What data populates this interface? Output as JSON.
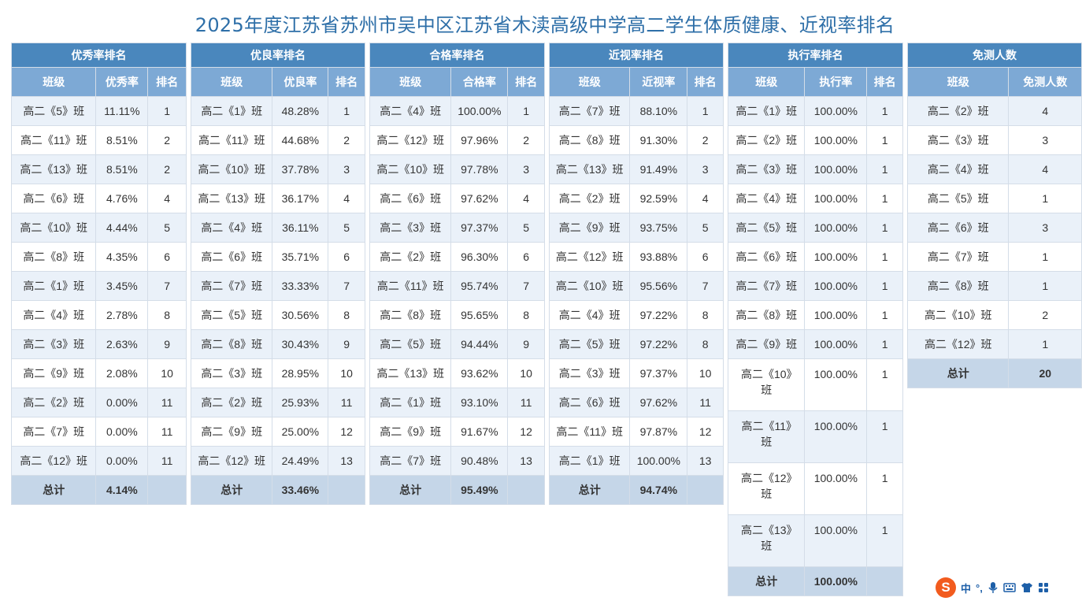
{
  "page": {
    "title": "2025年度江苏省苏州市吴中区江苏省木渎高级中学高二学生体质健康、近视率排名"
  },
  "tables": [
    {
      "id": "excellent",
      "group_label": "优秀率排名",
      "col_class": "班级",
      "col_value": "优秀率",
      "col_rank": "排名",
      "rows": [
        {
          "class": "高二《5》班",
          "value": "11.11%",
          "rank": "1"
        },
        {
          "class": "高二《11》班",
          "value": "8.51%",
          "rank": "2"
        },
        {
          "class": "高二《13》班",
          "value": "8.51%",
          "rank": "2"
        },
        {
          "class": "高二《6》班",
          "value": "4.76%",
          "rank": "4"
        },
        {
          "class": "高二《10》班",
          "value": "4.44%",
          "rank": "5"
        },
        {
          "class": "高二《8》班",
          "value": "4.35%",
          "rank": "6"
        },
        {
          "class": "高二《1》班",
          "value": "3.45%",
          "rank": "7"
        },
        {
          "class": "高二《4》班",
          "value": "2.78%",
          "rank": "8"
        },
        {
          "class": "高二《3》班",
          "value": "2.63%",
          "rank": "9"
        },
        {
          "class": "高二《9》班",
          "value": "2.08%",
          "rank": "10"
        },
        {
          "class": "高二《2》班",
          "value": "0.00%",
          "rank": "11"
        },
        {
          "class": "高二《7》班",
          "value": "0.00%",
          "rank": "11"
        },
        {
          "class": "高二《12》班",
          "value": "0.00%",
          "rank": "11"
        }
      ],
      "total_label": "总计",
      "total_value": "4.14%"
    },
    {
      "id": "good",
      "group_label": "优良率排名",
      "col_class": "班级",
      "col_value": "优良率",
      "col_rank": "排名",
      "rows": [
        {
          "class": "高二《1》班",
          "value": "48.28%",
          "rank": "1"
        },
        {
          "class": "高二《11》班",
          "value": "44.68%",
          "rank": "2"
        },
        {
          "class": "高二《10》班",
          "value": "37.78%",
          "rank": "3"
        },
        {
          "class": "高二《13》班",
          "value": "36.17%",
          "rank": "4"
        },
        {
          "class": "高二《4》班",
          "value": "36.11%",
          "rank": "5"
        },
        {
          "class": "高二《6》班",
          "value": "35.71%",
          "rank": "6"
        },
        {
          "class": "高二《7》班",
          "value": "33.33%",
          "rank": "7"
        },
        {
          "class": "高二《5》班",
          "value": "30.56%",
          "rank": "8"
        },
        {
          "class": "高二《8》班",
          "value": "30.43%",
          "rank": "9"
        },
        {
          "class": "高二《3》班",
          "value": "28.95%",
          "rank": "10"
        },
        {
          "class": "高二《2》班",
          "value": "25.93%",
          "rank": "11"
        },
        {
          "class": "高二《9》班",
          "value": "25.00%",
          "rank": "12"
        },
        {
          "class": "高二《12》班",
          "value": "24.49%",
          "rank": "13"
        }
      ],
      "total_label": "总计",
      "total_value": "33.46%"
    },
    {
      "id": "pass",
      "group_label": "合格率排名",
      "col_class": "班级",
      "col_value": "合格率",
      "col_rank": "排名",
      "rows": [
        {
          "class": "高二《4》班",
          "value": "100.00%",
          "rank": "1"
        },
        {
          "class": "高二《12》班",
          "value": "97.96%",
          "rank": "2"
        },
        {
          "class": "高二《10》班",
          "value": "97.78%",
          "rank": "3"
        },
        {
          "class": "高二《6》班",
          "value": "97.62%",
          "rank": "4"
        },
        {
          "class": "高二《3》班",
          "value": "97.37%",
          "rank": "5"
        },
        {
          "class": "高二《2》班",
          "value": "96.30%",
          "rank": "6"
        },
        {
          "class": "高二《11》班",
          "value": "95.74%",
          "rank": "7"
        },
        {
          "class": "高二《8》班",
          "value": "95.65%",
          "rank": "8"
        },
        {
          "class": "高二《5》班",
          "value": "94.44%",
          "rank": "9"
        },
        {
          "class": "高二《13》班",
          "value": "93.62%",
          "rank": "10"
        },
        {
          "class": "高二《1》班",
          "value": "93.10%",
          "rank": "11"
        },
        {
          "class": "高二《9》班",
          "value": "91.67%",
          "rank": "12"
        },
        {
          "class": "高二《7》班",
          "value": "90.48%",
          "rank": "13"
        }
      ],
      "total_label": "总计",
      "total_value": "95.49%"
    },
    {
      "id": "myopia",
      "group_label": "近视率排名",
      "col_class": "班级",
      "col_value": "近视率",
      "col_rank": "排名",
      "rows": [
        {
          "class": "高二《7》班",
          "value": "88.10%",
          "rank": "1"
        },
        {
          "class": "高二《8》班",
          "value": "91.30%",
          "rank": "2"
        },
        {
          "class": "高二《13》班",
          "value": "91.49%",
          "rank": "3"
        },
        {
          "class": "高二《2》班",
          "value": "92.59%",
          "rank": "4"
        },
        {
          "class": "高二《9》班",
          "value": "93.75%",
          "rank": "5"
        },
        {
          "class": "高二《12》班",
          "value": "93.88%",
          "rank": "6"
        },
        {
          "class": "高二《10》班",
          "value": "95.56%",
          "rank": "7"
        },
        {
          "class": "高二《4》班",
          "value": "97.22%",
          "rank": "8"
        },
        {
          "class": "高二《5》班",
          "value": "97.22%",
          "rank": "8"
        },
        {
          "class": "高二《3》班",
          "value": "97.37%",
          "rank": "10"
        },
        {
          "class": "高二《6》班",
          "value": "97.62%",
          "rank": "11"
        },
        {
          "class": "高二《11》班",
          "value": "97.87%",
          "rank": "12"
        },
        {
          "class": "高二《1》班",
          "value": "100.00%",
          "rank": "13"
        }
      ],
      "total_label": "总计",
      "total_value": "94.74%"
    },
    {
      "id": "execution",
      "group_label": "执行率排名",
      "col_class": "班级",
      "col_value": "执行率",
      "col_rank": "排名",
      "rows": [
        {
          "class": "高二《1》班",
          "value": "100.00%",
          "rank": "1"
        },
        {
          "class": "高二《2》班",
          "value": "100.00%",
          "rank": "1"
        },
        {
          "class": "高二《3》班",
          "value": "100.00%",
          "rank": "1"
        },
        {
          "class": "高二《4》班",
          "value": "100.00%",
          "rank": "1"
        },
        {
          "class": "高二《5》班",
          "value": "100.00%",
          "rank": "1"
        },
        {
          "class": "高二《6》班",
          "value": "100.00%",
          "rank": "1"
        },
        {
          "class": "高二《7》班",
          "value": "100.00%",
          "rank": "1"
        },
        {
          "class": "高二《8》班",
          "value": "100.00%",
          "rank": "1"
        },
        {
          "class": "高二《9》班",
          "value": "100.00%",
          "rank": "1"
        },
        {
          "class": "高二《10》班",
          "value": "100.00%",
          "rank": "1",
          "wrap": true
        },
        {
          "class": "高二《11》班",
          "value": "100.00%",
          "rank": "1",
          "wrap": true
        },
        {
          "class": "高二《12》班",
          "value": "100.00%",
          "rank": "1",
          "wrap": true
        },
        {
          "class": "高二《13》班",
          "value": "100.00%",
          "rank": "1",
          "wrap": true
        }
      ],
      "total_label": "总计",
      "total_value": "100.00%"
    },
    {
      "id": "exempt",
      "group_label": "免测人数",
      "col_class": "班级",
      "col_value": "免测人数",
      "rows": [
        {
          "class": "高二《2》班",
          "value": "4"
        },
        {
          "class": "高二《3》班",
          "value": "3"
        },
        {
          "class": "高二《4》班",
          "value": "4"
        },
        {
          "class": "高二《5》班",
          "value": "1"
        },
        {
          "class": "高二《6》班",
          "value": "3"
        },
        {
          "class": "高二《7》班",
          "value": "1"
        },
        {
          "class": "高二《8》班",
          "value": "1"
        },
        {
          "class": "高二《10》班",
          "value": "2"
        },
        {
          "class": "高二《12》班",
          "value": "1"
        }
      ],
      "total_label": "总计",
      "total_value": "20"
    }
  ],
  "ime": {
    "logo": "S",
    "lang": "中",
    "punct": "°,",
    "icons": [
      "microphone-icon",
      "keyboard-icon",
      "tshirt-icon",
      "grid-icon"
    ]
  }
}
